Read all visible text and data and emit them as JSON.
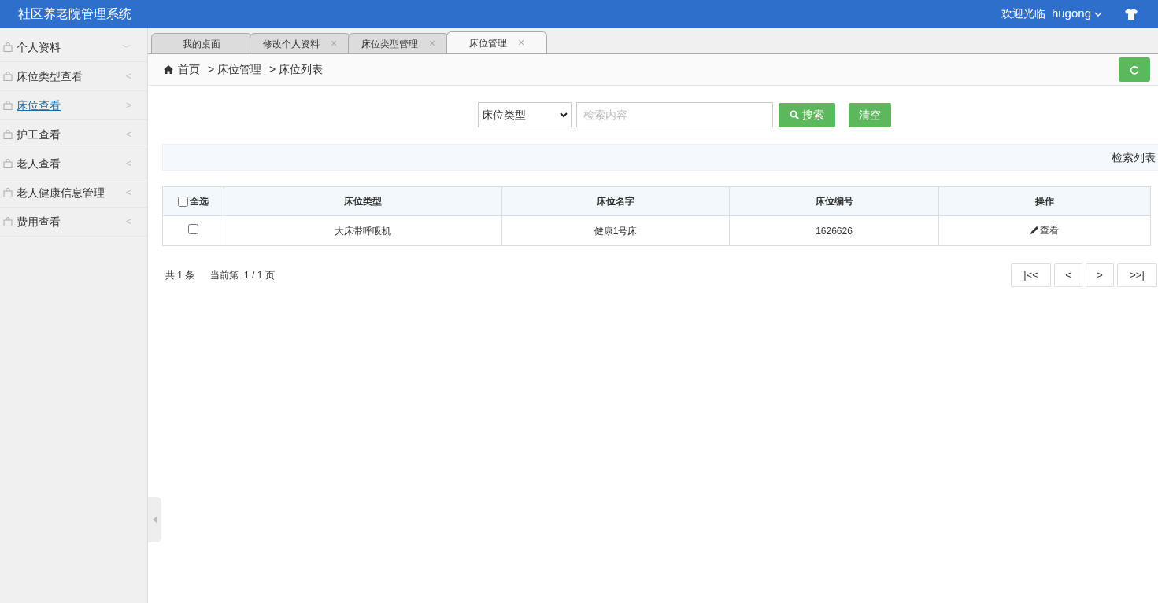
{
  "header": {
    "title": "社区养老院管理系统",
    "welcome": "欢迎光临",
    "user": "hugong"
  },
  "sidebar": {
    "items": [
      {
        "label": "个人资料",
        "arrow": "﹀",
        "selected": false
      },
      {
        "label": "床位类型查看",
        "arrow": "<",
        "selected": false
      },
      {
        "label": "床位查看",
        "arrow": ">",
        "selected": true
      },
      {
        "label": "护工查看",
        "arrow": "<",
        "selected": false
      },
      {
        "label": "老人查看",
        "arrow": "<",
        "selected": false
      },
      {
        "label": "老人健康信息管理",
        "arrow": "<",
        "selected": false
      },
      {
        "label": "费用查看",
        "arrow": "<",
        "selected": false
      }
    ]
  },
  "tabs": [
    {
      "label": "我的桌面",
      "selected": false
    },
    {
      "label": "修改个人资料",
      "close": "×",
      "selected": false
    },
    {
      "label": "床位类型管理",
      "close": "×",
      "selected": false
    },
    {
      "label": "床位管理",
      "close": "×",
      "selected": true
    }
  ],
  "breadcrumb": [
    "首页",
    "> 床位管理",
    "> 床位列表"
  ],
  "search": {
    "select_value": "床位类型",
    "placeholder": "检索内容",
    "search_button": "搜索",
    "clear_button": "清空"
  },
  "panel_title": "检索列表",
  "table": {
    "select_all": "全选",
    "select_all_checked": false,
    "columns": [
      "床位类型",
      "床位名字",
      "床位编号",
      "操作"
    ],
    "rows": [
      {
        "checked": false,
        "cells": [
          "大床带呼吸机",
          "健康1号床",
          "1626626"
        ],
        "action": "查看"
      }
    ]
  },
  "footer": {
    "total": "共 1 条",
    "page": "当前第  1 / 1 页",
    "pager": [
      "|<<",
      "<",
      ">",
      ">>|"
    ]
  }
}
